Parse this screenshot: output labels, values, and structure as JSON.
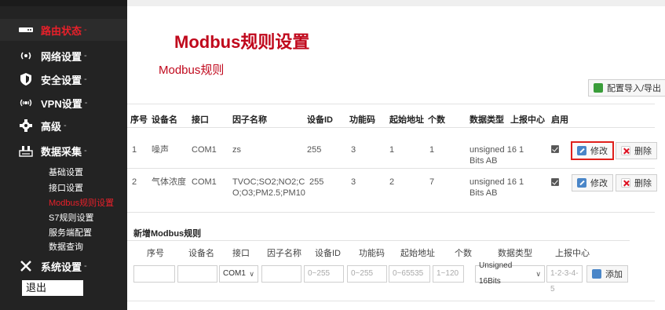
{
  "sidebar": {
    "items": [
      {
        "label": "路由状态",
        "icon": "router-icon",
        "arrow": "-"
      },
      {
        "label": "网络设置",
        "icon": "network-icon",
        "arrow": "-"
      },
      {
        "label": "安全设置",
        "icon": "shield-icon",
        "arrow": "-"
      },
      {
        "label": "VPN设置",
        "icon": "wifi-icon",
        "arrow": "-"
      },
      {
        "label": "高级",
        "icon": "gear-icon",
        "arrow": "-"
      },
      {
        "label": "数据采集",
        "icon": "data-icon",
        "arrow": "-"
      },
      {
        "label": "系统设置",
        "icon": "tools-icon",
        "arrow": "-"
      }
    ],
    "sub_items": [
      "基础设置",
      "接口设置",
      "Modbus规则设置",
      "S7规则设置",
      "服务端配置",
      "数据查询"
    ],
    "logout": "退出"
  },
  "page": {
    "title": "Modbus规则设置",
    "subtitle": "Modbus规则",
    "import_export": "配置导入/导出"
  },
  "table": {
    "headers": [
      "序号",
      "设备名",
      "接口",
      "因子名称",
      "设备ID",
      "功能码",
      "起始地址",
      "个数",
      "数据类型",
      "上报中心",
      "启用"
    ],
    "rows": [
      {
        "index": "1",
        "device": "噪声",
        "port": "COM1",
        "factor": "zs",
        "device_id": "255",
        "func": "3",
        "start": "1",
        "count": "1",
        "dtype": "unsigned 16 1 Bits AB",
        "center": "",
        "enabled": true,
        "edit": "修改",
        "delete": "删除"
      },
      {
        "index": "2",
        "device": "气体浓度",
        "port": "COM1",
        "factor": "TVOC;SO2;NO2;CO;O3;PM2.5;PM10",
        "device_id": "255",
        "func": "3",
        "start": "2",
        "count": "7",
        "dtype": "unsigned 16 1 Bits AB",
        "center": "",
        "enabled": true,
        "edit": "修改",
        "delete": "删除"
      }
    ]
  },
  "new_rule": {
    "title": "新增Modbus规则",
    "headers": [
      "序号",
      "设备名",
      "接口",
      "因子名称",
      "设备ID",
      "功能码",
      "起始地址",
      "个数",
      "数据类型",
      "上报中心"
    ],
    "port_value": "COM1",
    "device_id_placeholder": "0~255",
    "func_placeholder": "0~255",
    "start_placeholder": "0~65535",
    "count_placeholder": "1~120",
    "dtype_value": "Unsigned 16Bits",
    "center_placeholder": "1-2-3-4-5",
    "add_label": "添加"
  },
  "colors": {
    "accent": "#c0081c",
    "sidebar_bg": "#232323",
    "highlight_border": "#e0201c"
  }
}
